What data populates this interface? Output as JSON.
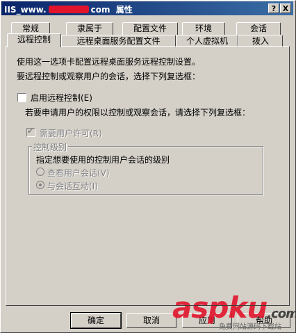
{
  "window": {
    "title_prefix": "IIS_www.",
    "title_suffix": "com",
    "title_word": "属性",
    "help_btn": "?",
    "close_btn": "X"
  },
  "tabs_back": [
    "常规",
    "隶属于",
    "配置文件",
    "环境",
    "会话"
  ],
  "tabs_front": [
    "远程控制",
    "远程桌面服务配置文件",
    "个人虚拟机",
    "拨入"
  ],
  "panel": {
    "intro1": "使用这一选项卡配置远程桌面服务远程控制设置。",
    "intro2": "要远程控制或观察用户的会话，选择下列复选框：",
    "enable_label": "启用远程控制(E)",
    "sub_text": "若要申请用户的权限以控制或观察会话，请选择下列复选框：",
    "require_perm": "需要用户许可(R)",
    "group_label": "控制级别",
    "group_desc": "指定想要使用的控制用户会话的级别",
    "radio_view": "查看用户会话(V)",
    "radio_interact": "与会话互动(I)"
  },
  "buttons": {
    "ok": "确定",
    "cancel": "取消",
    "apply": "应用",
    "help": "帮助"
  },
  "watermark": {
    "brand": "aspku",
    "tld": ".com",
    "slogan": "免费网站源码下载站"
  }
}
